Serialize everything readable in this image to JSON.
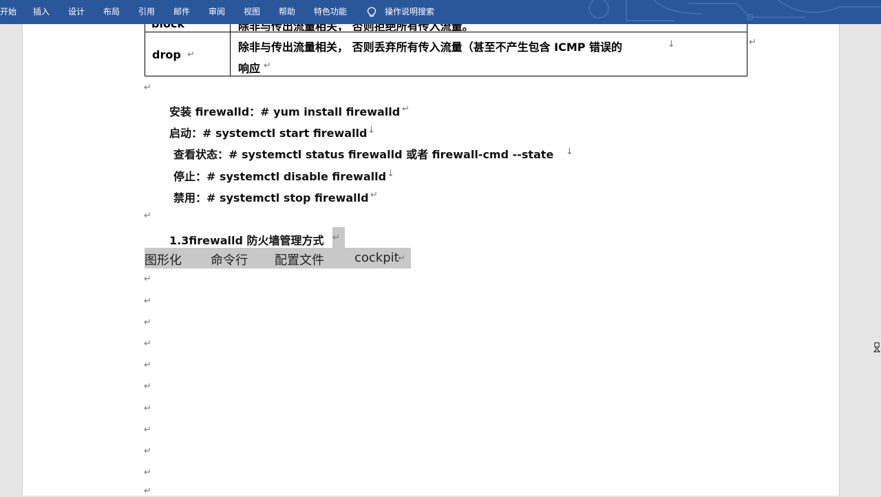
{
  "ribbon": {
    "tabs": [
      {
        "label": "开始"
      },
      {
        "label": "插入"
      },
      {
        "label": "设计"
      },
      {
        "label": "布局"
      },
      {
        "label": "引用"
      },
      {
        "label": "邮件"
      },
      {
        "label": "审阅"
      },
      {
        "label": "视图"
      },
      {
        "label": "帮助"
      },
      {
        "label": "特色功能"
      }
    ],
    "tell_me": "操作说明搜索",
    "icon": "lightbulb-icon",
    "color": "#2b579a"
  },
  "table": {
    "rows": [
      {
        "name": "block",
        "desc": "除非与传出流量相关，  否则拒绝所有传入流量。"
      },
      {
        "name": "drop",
        "desc_line1": "除非与传出流量相关，  否则丢弃所有传入流量（甚至不产生包含 ICMP 错误的",
        "desc_line2": "响应"
      }
    ]
  },
  "commands": [
    {
      "text": "安装 firewalld：# yum install firewalld"
    },
    {
      "text": "启动：# systemctl start firewalld"
    },
    {
      "text": "查看状态：# systemctl status firewalld  或者  firewall-cmd --state"
    },
    {
      "text": "停止：# systemctl disable firewalld"
    },
    {
      "text": "禁用：# systemctl stop firewalld"
    }
  ],
  "section_heading": "1.3firewalld 防火墙管理方式",
  "management_modes": [
    "图形化",
    "命令行",
    "配置文件",
    "cockpit"
  ],
  "paragraph_mark": "↵",
  "line_break_mark": "↓"
}
